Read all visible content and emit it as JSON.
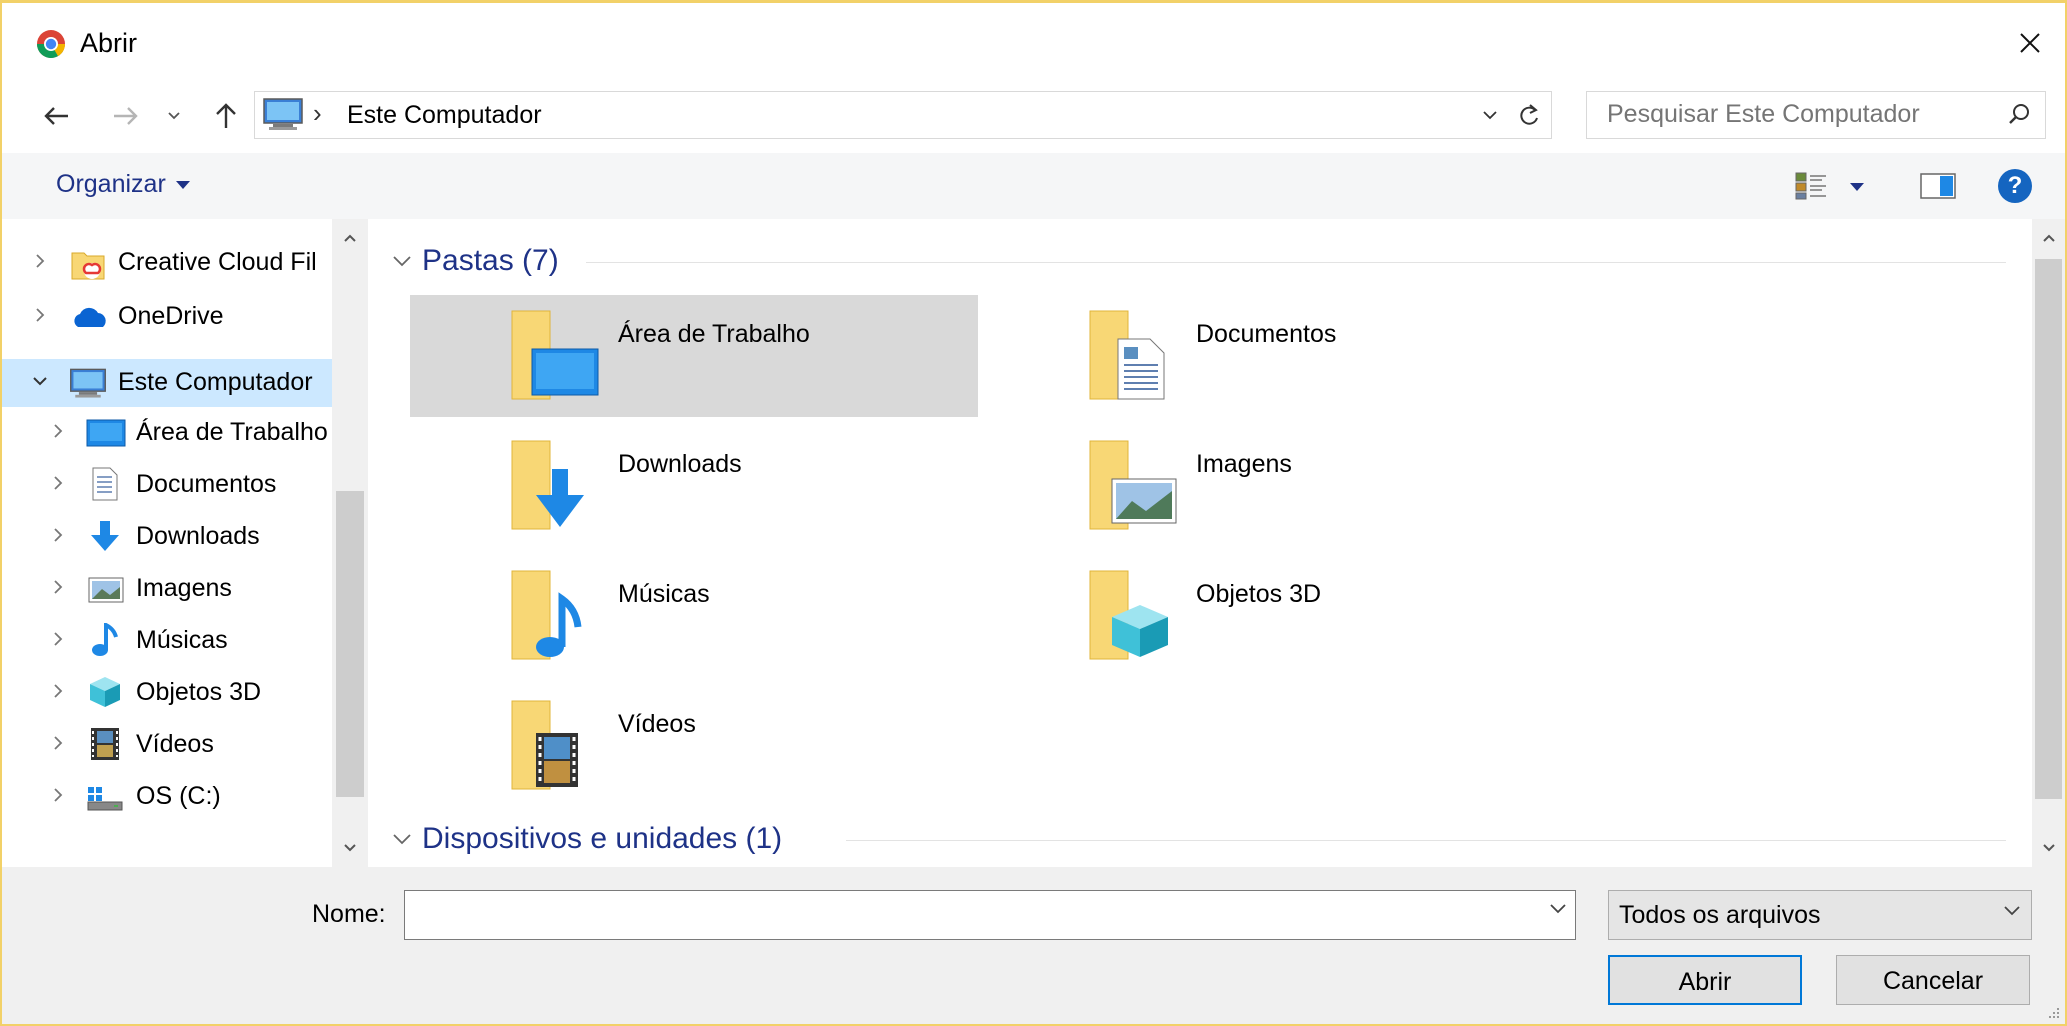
{
  "window": {
    "title": "Abrir",
    "app_icon": "chrome-icon",
    "border_color": "#f2d168"
  },
  "navigation": {
    "back_icon": "arrow-left-icon",
    "forward_icon": "arrow-right-icon",
    "recent_icon": "chevron-down-icon",
    "up_icon": "arrow-up-icon",
    "breadcrumb_separator": "›",
    "location": "Este Computador",
    "refresh_icon": "refresh-icon",
    "search_placeholder": "Pesquisar Este Computador"
  },
  "commandbar": {
    "organize_label": "Organizar",
    "view_icon": "view-options-icon",
    "preview_icon": "preview-pane-icon",
    "help_label": "?"
  },
  "sidebar": {
    "items": [
      {
        "label": "Creative Cloud Fil",
        "icon": "creative-cloud-icon",
        "expanded": false
      },
      {
        "label": "OneDrive",
        "icon": "onedrive-cloud-icon",
        "expanded": false
      },
      {
        "label": "Este Computador",
        "icon": "computer-icon",
        "expanded": true,
        "selected": true
      },
      {
        "label": "Área de Trabalho",
        "icon": "desktop-icon",
        "expanded": false
      },
      {
        "label": "Documentos",
        "icon": "documents-icon",
        "expanded": false
      },
      {
        "label": "Downloads",
        "icon": "downloads-icon",
        "expanded": false
      },
      {
        "label": "Imagens",
        "icon": "pictures-icon",
        "expanded": false
      },
      {
        "label": "Músicas",
        "icon": "music-icon",
        "expanded": false
      },
      {
        "label": "Objetos 3D",
        "icon": "3d-objects-icon",
        "expanded": false
      },
      {
        "label": "Vídeos",
        "icon": "videos-icon",
        "expanded": false
      },
      {
        "label": "OS (C:)",
        "icon": "drive-icon",
        "expanded": false
      }
    ]
  },
  "main": {
    "groups": [
      {
        "title": "Pastas (7)",
        "items": [
          {
            "label": "Área de Trabalho",
            "icon": "desktop-folder-icon",
            "highlighted": true
          },
          {
            "label": "Documentos",
            "icon": "documents-folder-icon"
          },
          {
            "label": "Downloads",
            "icon": "downloads-folder-icon"
          },
          {
            "label": "Imagens",
            "icon": "pictures-folder-icon"
          },
          {
            "label": "Músicas",
            "icon": "music-folder-icon"
          },
          {
            "label": "Objetos 3D",
            "icon": "3d-objects-folder-icon"
          },
          {
            "label": "Vídeos",
            "icon": "videos-folder-icon"
          }
        ]
      },
      {
        "title": "Dispositivos e unidades (1)",
        "items": []
      }
    ]
  },
  "footer": {
    "name_label": "Nome:",
    "name_value": "",
    "filter_value": "Todos os arquivos",
    "open_button": "Abrir",
    "cancel_button": "Cancelar"
  },
  "colors": {
    "accent": "#1e3287",
    "selection": "#cce8ff",
    "hover": "#d9d9d9",
    "folder": "#f8d775",
    "blue": "#1e88e5"
  }
}
